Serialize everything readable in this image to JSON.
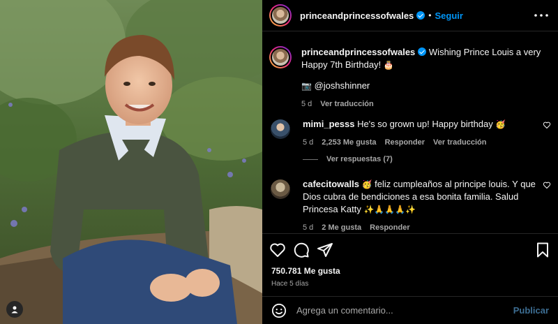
{
  "post": {
    "username": "princeandprincessofwales",
    "follow_label": "Seguir",
    "separator": "•",
    "caption_text": "Wishing Prince Louis a very Happy 7th Birthday!",
    "caption_emoji": "🎂",
    "credit_emoji": "📷",
    "credit_handle": "@joshshinner",
    "caption_age": "5 d",
    "caption_translate": "Ver traducción"
  },
  "comments": [
    {
      "username": "mimi_pesss",
      "text": "He's so grown up! Happy birthday",
      "emoji": "🥳",
      "age": "5 d",
      "likes": "2,253 Me gusta",
      "reply": "Responder",
      "translate": "Ver traducción",
      "view_replies": "Ver respuestas (7)"
    },
    {
      "username": "cafecitowalls",
      "emoji_lead": "🥳",
      "text": "feliz cumpleaños al principe louis. Y que Dios cubra de bendiciones a esa bonita familia. Salud Princesa Katty",
      "emoji_tail": "✨🙏🙏🙏✨",
      "age": "5 d",
      "likes": "2 Me gusta",
      "reply": "Responder"
    }
  ],
  "actions": {
    "icons": [
      "heart-icon",
      "comment-icon",
      "share-icon",
      "bookmark-icon"
    ]
  },
  "likes_count": "750.781 Me gusta",
  "posted_time": "Hace 5 días",
  "comment_box": {
    "placeholder": "Agrega un comentario...",
    "publish_label": "Publicar"
  },
  "colors": {
    "accent": "#0095f6",
    "background": "#000000",
    "muted": "#a8a8a8",
    "publish_disabled": "#3d6e93"
  }
}
